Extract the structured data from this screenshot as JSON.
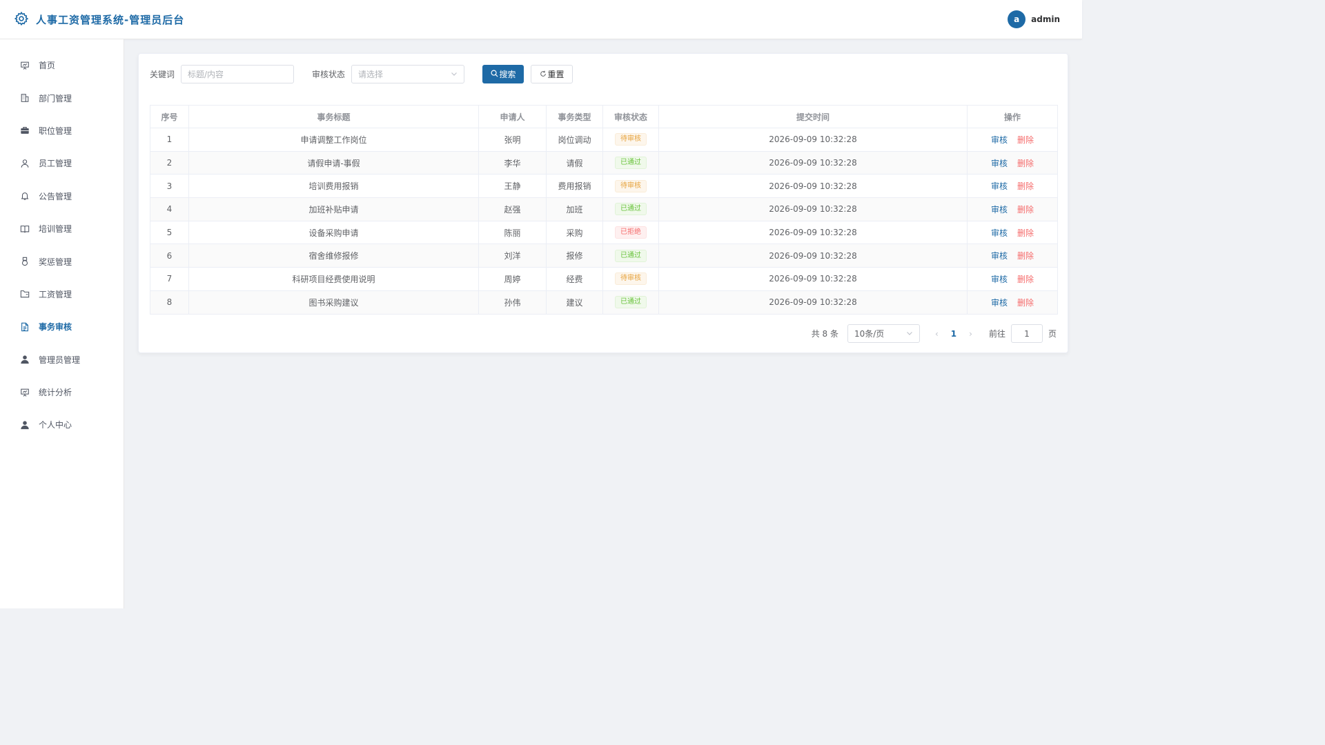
{
  "header": {
    "title": "人事工资管理系统-管理员后台",
    "avatar_letter": "a",
    "username": "admin",
    "brand_color": "#1e6aa6"
  },
  "sidebar": {
    "items": [
      {
        "label": "首页",
        "icon": "presentation-icon"
      },
      {
        "label": "部门管理",
        "icon": "building-icon"
      },
      {
        "label": "职位管理",
        "icon": "briefcase-icon"
      },
      {
        "label": "员工管理",
        "icon": "user-icon"
      },
      {
        "label": "公告管理",
        "icon": "bell-icon"
      },
      {
        "label": "培训管理",
        "icon": "book-icon"
      },
      {
        "label": "奖惩管理",
        "icon": "medal-icon"
      },
      {
        "label": "工资管理",
        "icon": "folder-icon"
      },
      {
        "label": "事务审核",
        "icon": "document-icon",
        "active": true
      },
      {
        "label": "管理员管理",
        "icon": "user-filled-icon"
      },
      {
        "label": "统计分析",
        "icon": "presentation-icon"
      },
      {
        "label": "个人中心",
        "icon": "user-filled-icon"
      }
    ]
  },
  "filters": {
    "keyword_label": "关键词",
    "keyword_placeholder": "标题/内容",
    "status_label": "审核状态",
    "status_placeholder": "请选择",
    "search_label": "搜索",
    "reset_label": "重置"
  },
  "table": {
    "columns": [
      "序号",
      "事务标题",
      "申请人",
      "事务类型",
      "审核状态",
      "提交时间",
      "操作"
    ],
    "review_label": "审核",
    "delete_label": "删除",
    "rows": [
      {
        "no": "1",
        "title": "申请调整工作岗位",
        "applicant": "张明",
        "type": "岗位调动",
        "status": "待审核",
        "time": "2026-09-09 10:32:28"
      },
      {
        "no": "2",
        "title": "请假申请-事假",
        "applicant": "李华",
        "type": "请假",
        "status": "已通过",
        "time": "2026-09-09 10:32:28"
      },
      {
        "no": "3",
        "title": "培训费用报销",
        "applicant": "王静",
        "type": "费用报销",
        "status": "待审核",
        "time": "2026-09-09 10:32:28"
      },
      {
        "no": "4",
        "title": "加班补贴申请",
        "applicant": "赵强",
        "type": "加班",
        "status": "已通过",
        "time": "2026-09-09 10:32:28"
      },
      {
        "no": "5",
        "title": "设备采购申请",
        "applicant": "陈丽",
        "type": "采购",
        "status": "已拒绝",
        "time": "2026-09-09 10:32:28"
      },
      {
        "no": "6",
        "title": "宿舍维修报修",
        "applicant": "刘洋",
        "type": "报修",
        "status": "已通过",
        "time": "2026-09-09 10:32:28"
      },
      {
        "no": "7",
        "title": "科研项目经费使用说明",
        "applicant": "周婷",
        "type": "经费",
        "status": "待审核",
        "time": "2026-09-09 10:32:28"
      },
      {
        "no": "8",
        "title": "图书采购建议",
        "applicant": "孙伟",
        "type": "建议",
        "status": "已通过",
        "time": "2026-09-09 10:32:28"
      }
    ]
  },
  "status_styles": {
    "待审核": {
      "color": "#e6a23c",
      "bg": "#fdf6ec",
      "border": "#faecd8"
    },
    "已通过": {
      "color": "#67c23a",
      "bg": "#f0f9eb",
      "border": "#e1f3d8"
    },
    "已拒绝": {
      "color": "#f56c6c",
      "bg": "#fef0f0",
      "border": "#fde2e2"
    }
  },
  "pagination": {
    "total_text": "共 8 条",
    "page_size": "10条/页",
    "current_page": "1",
    "goto_label": "前往",
    "goto_value": "1",
    "page_suffix": "页"
  }
}
